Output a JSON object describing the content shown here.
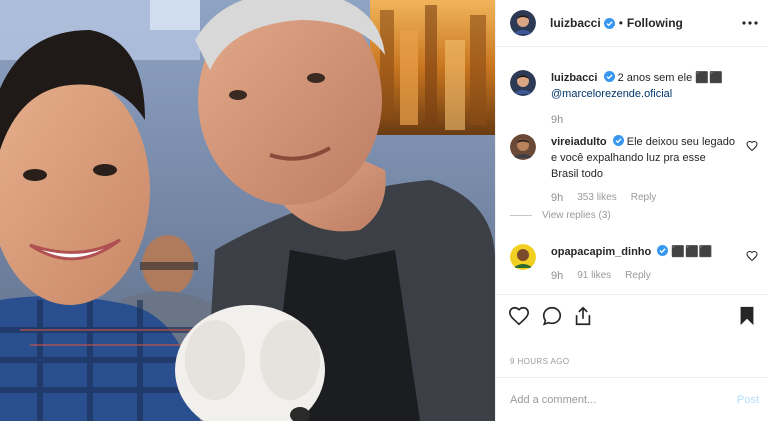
{
  "post": {
    "header": {
      "username": "luizbacci",
      "separator": "•",
      "follow_status": "Following"
    },
    "caption": {
      "username": "luizbacci",
      "text": "2 anos sem ele ⬛⬛",
      "mention": "@marcelorezende.oficial",
      "time": "9h"
    },
    "comments": [
      {
        "username": "vireiadulto",
        "text": "Ele deixou seu legado e você expalhando luz pra esse Brasil todo",
        "time": "9h",
        "likes": "353 likes",
        "reply_label": "Reply",
        "view_replies": "View replies (3)"
      },
      {
        "username": "opapacapim_dinho",
        "text": "⬛⬛⬛",
        "time": "9h",
        "likes": "91 likes",
        "reply_label": "Reply"
      }
    ],
    "timestamp": "9 HOURS AGO",
    "add_comment_placeholder": "Add a comment...",
    "post_button": "Post",
    "icons": {
      "verified": "verified-badge-icon",
      "more": "more-options-icon",
      "like": "heart-icon",
      "comment": "comment-icon",
      "share": "share-icon",
      "save": "bookmark-icon"
    },
    "colors": {
      "verified": "#3897f0",
      "muted": "#999999",
      "post_disabled": "#b2dffc"
    }
  }
}
